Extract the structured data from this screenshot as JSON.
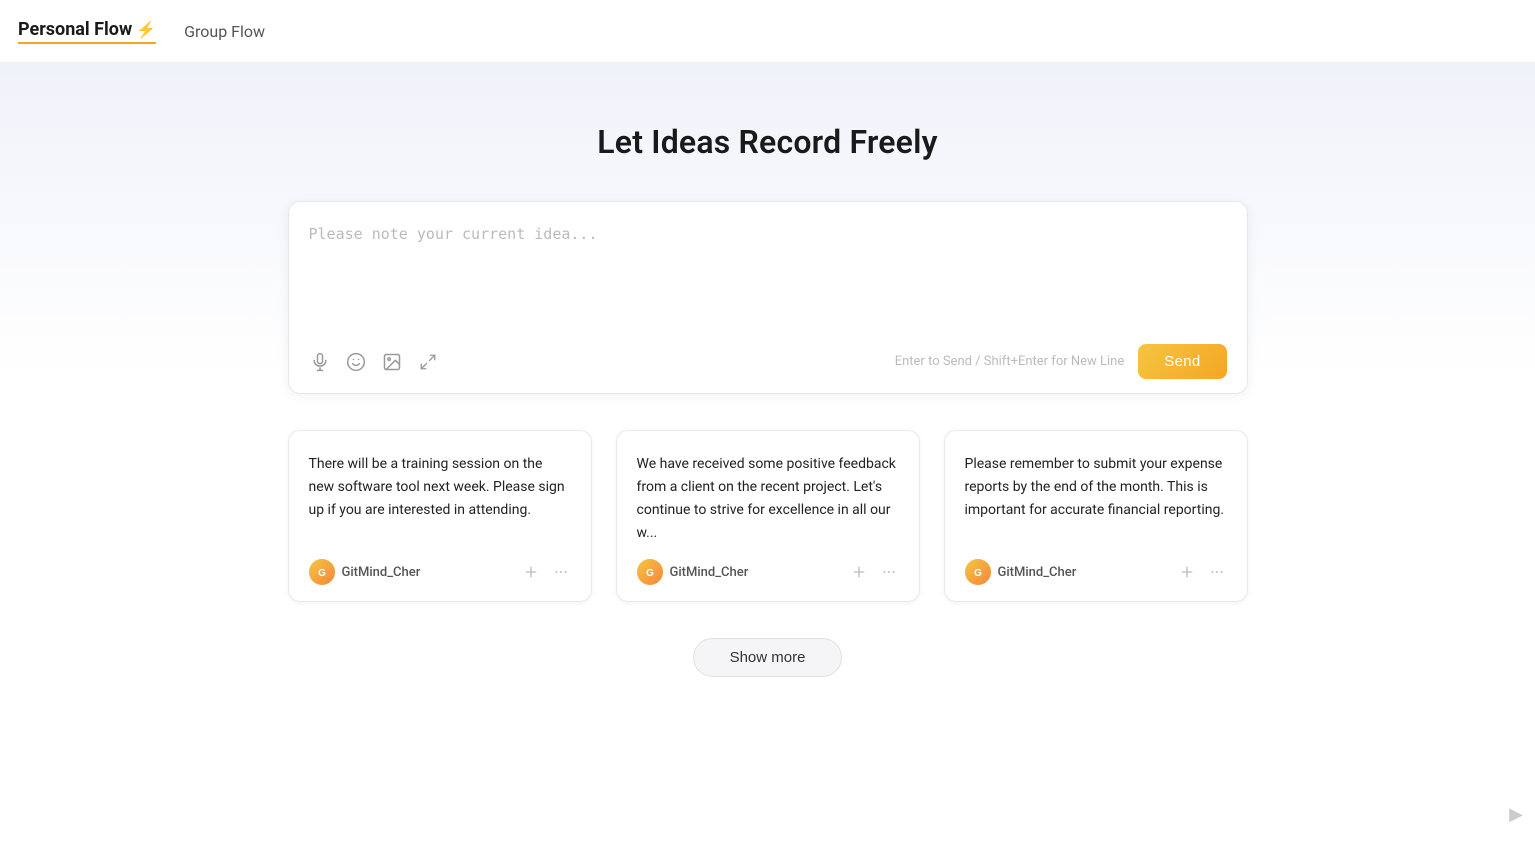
{
  "nav": {
    "personal_flow_label": "Personal Flow",
    "personal_flow_lightning": "⚡",
    "group_flow_label": "Group Flow"
  },
  "main": {
    "headline": "Let Ideas Record Freely",
    "input": {
      "placeholder": "Please note your current idea...",
      "hint": "Enter to Send / Shift+Enter for New Line",
      "send_label": "Send"
    },
    "icons": {
      "mic": "🎙",
      "emoji": "🙂",
      "image": "🖼",
      "expand": "⤢"
    },
    "cards": [
      {
        "text": "There will be a training session on the new software tool next week. Please sign up if you are interested in attending.",
        "username": "GitMind_Cher"
      },
      {
        "text": "We have received some positive feedback from a client on the recent project. Let's continue to strive for excellence in all our w...",
        "username": "GitMind_Cher"
      },
      {
        "text": "Please remember to submit your expense reports by the end of the month. This is important for accurate financial reporting.",
        "username": "GitMind_Cher"
      }
    ],
    "show_more_label": "Show more"
  }
}
